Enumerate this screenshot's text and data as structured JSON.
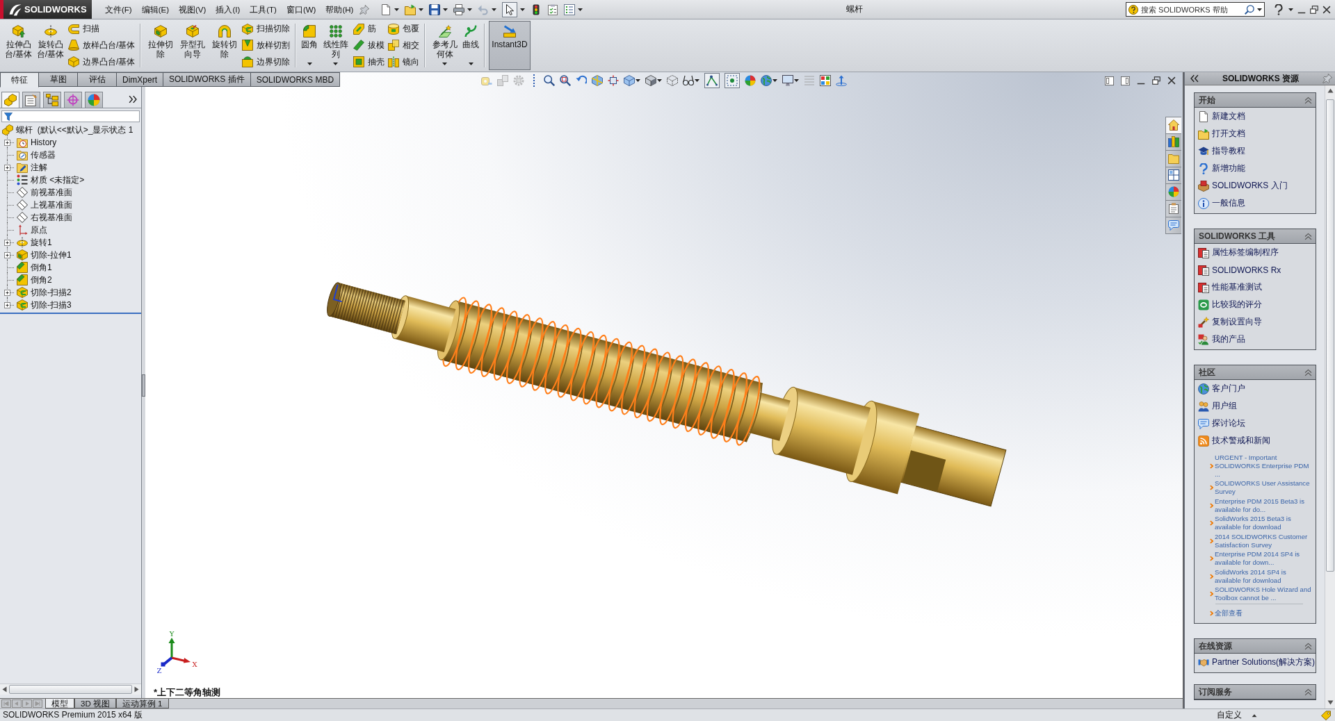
{
  "app": {
    "logo": "SOLIDWORKS"
  },
  "menu": [
    "文件(F)",
    "编辑(E)",
    "视图(V)",
    "插入(I)",
    "工具(T)",
    "窗口(W)",
    "帮助(H)"
  ],
  "quick_access": [
    {
      "dropdown": true,
      "on": false,
      "disabled": false
    },
    {
      "dropdown": true,
      "on": false,
      "disabled": false
    },
    {
      "dropdown": true,
      "on": false,
      "disabled": false
    },
    {
      "dropdown": true,
      "on": false,
      "disabled": false
    },
    {
      "dropdown": true,
      "on": false,
      "disabled": true
    },
    {
      "dropdown": true,
      "on": true,
      "disabled": false
    },
    {
      "dropdown": false,
      "on": false,
      "disabled": false
    },
    {
      "dropdown": false,
      "on": false,
      "disabled": false
    },
    {
      "dropdown": true,
      "on": false,
      "disabled": false
    }
  ],
  "window": {
    "title": "螺杆"
  },
  "search": {
    "placeholder": "搜索 SOLIDWORKS 帮助"
  },
  "ribbon": {
    "groups": [
      {
        "items": [
          {
            "kind": "large",
            "label": "拉伸凸台/基体",
            "dropdown": false,
            "on": false
          },
          {
            "kind": "large",
            "label": "旋转凸台/基体",
            "dropdown": false,
            "on": false
          },
          {
            "kind": "stack",
            "items": [
              {
                "label": "扫描"
              },
              {
                "label": "放样凸台/基体"
              },
              {
                "label": "边界凸台/基体"
              }
            ]
          }
        ]
      },
      {
        "items": [
          {
            "kind": "large",
            "label": "拉伸切除",
            "dropdown": false,
            "on": false
          },
          {
            "kind": "large",
            "label": "异型孔向导",
            "dropdown": false,
            "on": false
          },
          {
            "kind": "large",
            "label": "旋转切除",
            "dropdown": false,
            "on": false
          },
          {
            "kind": "stack",
            "items": [
              {
                "label": "扫描切除"
              },
              {
                "label": "放样切割"
              },
              {
                "label": "边界切除"
              }
            ]
          }
        ]
      },
      {
        "items": [
          {
            "kind": "large",
            "label": "圆角",
            "dropdown": true,
            "on": false
          },
          {
            "kind": "large",
            "label": "线性阵列",
            "dropdown": true,
            "on": false
          },
          {
            "kind": "stack",
            "items": [
              {
                "label": "筋"
              },
              {
                "label": "拔模"
              },
              {
                "label": "抽壳"
              }
            ]
          },
          {
            "kind": "stack",
            "items": [
              {
                "label": "包覆"
              },
              {
                "label": "相交"
              },
              {
                "label": "镜向"
              }
            ]
          }
        ]
      },
      {
        "items": [
          {
            "kind": "large",
            "label": "参考几何体",
            "dropdown": true,
            "on": false
          },
          {
            "kind": "large",
            "label": "曲线",
            "dropdown": true,
            "on": false
          }
        ]
      },
      {
        "items": [
          {
            "kind": "large",
            "label": "Instant3D",
            "dropdown": false,
            "on": true
          }
        ]
      }
    ]
  },
  "command_tabs": [
    {
      "label": "特征",
      "selected": true
    },
    {
      "label": "草图",
      "selected": false
    },
    {
      "label": "评估",
      "selected": false
    },
    {
      "label": "DimXpert",
      "selected": false
    },
    {
      "label": "SOLIDWORKS 插件",
      "selected": false
    },
    {
      "label": "SOLIDWORKS MBD",
      "selected": false
    }
  ],
  "view_toolbar": [
    {
      "dropdown": false,
      "on": false,
      "disabled": true
    },
    {
      "dropdown": false,
      "on": false,
      "disabled": true
    },
    {
      "dropdown": false,
      "on": false,
      "disabled": true
    },
    {
      "dropdown": false,
      "on": false,
      "disabled": false
    },
    {
      "dropdown": false,
      "on": false,
      "disabled": false
    },
    {
      "dropdown": false,
      "on": false,
      "disabled": false
    },
    {
      "dropdown": false,
      "on": false,
      "disabled": false
    },
    {
      "dropdown": false,
      "on": false,
      "disabled": false
    },
    {
      "dropdown": true,
      "on": false,
      "disabled": false
    },
    {
      "dropdown": true,
      "on": false,
      "disabled": false
    },
    {
      "dropdown": false,
      "on": false,
      "disabled": false
    },
    {
      "dropdown": true,
      "on": false,
      "disabled": false
    },
    {
      "dropdown": false,
      "on": true,
      "disabled": false
    },
    {
      "dropdown": false,
      "on": true,
      "disabled": false
    },
    {
      "dropdown": false,
      "on": false,
      "disabled": false
    },
    {
      "dropdown": true,
      "on": false,
      "disabled": false
    },
    {
      "dropdown": true,
      "on": false,
      "disabled": false
    },
    {
      "dropdown": false,
      "on": false,
      "disabled": true
    },
    {
      "dropdown": false,
      "on": false,
      "disabled": false
    },
    {
      "dropdown": false,
      "on": false,
      "disabled": false
    }
  ],
  "panel_tabs": [
    {
      "selected": true
    },
    {
      "selected": false
    },
    {
      "selected": false
    },
    {
      "selected": false
    },
    {
      "selected": false
    }
  ],
  "feature_tree": {
    "label": "螺杆  (默认<<默认>_显示状态 1",
    "children": [
      {
        "label": "History",
        "expandable": true
      },
      {
        "label": "传感器",
        "expandable": false
      },
      {
        "label": "注解",
        "expandable": true
      },
      {
        "label": "材质 <未指定>",
        "expandable": false
      },
      {
        "label": "前视基准面",
        "expandable": false
      },
      {
        "label": "上视基准面",
        "expandable": false
      },
      {
        "label": "右视基准面",
        "expandable": false
      },
      {
        "label": "原点",
        "expandable": false
      },
      {
        "label": "旋转1",
        "expandable": true
      },
      {
        "label": "切除-拉伸1",
        "expandable": true
      },
      {
        "label": "倒角1",
        "expandable": false
      },
      {
        "label": "倒角2",
        "expandable": false
      },
      {
        "label": "切除-扫描2",
        "expandable": true
      },
      {
        "label": "切除-扫描3",
        "expandable": true
      }
    ]
  },
  "viewport": {
    "view_name": "*上下二等角轴测",
    "triad": {
      "x": "X",
      "y": "Y",
      "z": "Z"
    }
  },
  "task_tabs": [
    {
      "selected": true
    },
    {
      "selected": false
    },
    {
      "selected": false
    },
    {
      "selected": false
    },
    {
      "selected": false
    },
    {
      "selected": false
    },
    {
      "selected": false
    }
  ],
  "task_pane": {
    "title": "SOLIDWORKS 资源",
    "sections": [
      {
        "title": "开始",
        "expanded": true,
        "items": [
          {
            "label": "新建文档"
          },
          {
            "label": "打开文档"
          },
          {
            "label": "指导教程"
          },
          {
            "label": "新增功能"
          },
          {
            "label": "SOLIDWORKS 入门"
          },
          {
            "label": "一般信息"
          }
        ]
      },
      {
        "title": "SOLIDWORKS 工具",
        "expanded": true,
        "items": [
          {
            "label": "属性标签编制程序"
          },
          {
            "label": "SOLIDWORKS Rx"
          },
          {
            "label": "性能基准测试"
          },
          {
            "label": "比较我的评分"
          },
          {
            "label": "复制设置向导"
          },
          {
            "label": "我的产品"
          }
        ]
      },
      {
        "title": "社区",
        "expanded": true,
        "items": [
          {
            "label": "客户门户"
          },
          {
            "label": "用户组"
          },
          {
            "label": "探讨论坛"
          },
          {
            "label": "技术警戒和新闻"
          }
        ],
        "news": [
          "URGENT - Important SOLIDWORKS Enterprise PDM ...",
          "SOLIDWORKS User Assistance Survey",
          "Enterprise PDM 2015 Beta3 is available for do...",
          "SolidWorks 2015 Beta3 is available for download",
          "2014 SOLIDWORKS Customer Satisfaction Survey",
          "Enterprise PDM 2014 SP4 is available for down...",
          "SolidWorks 2014 SP4 is available for download",
          "SOLIDWORKS Hole Wizard and Toolbox cannot be ..."
        ],
        "more": "全部查看"
      },
      {
        "title": "在线资源",
        "expanded": true,
        "items": [
          {
            "label": "Partner Solutions(解决方案)"
          }
        ]
      },
      {
        "title": "订阅服务",
        "expanded": true
      }
    ]
  },
  "bottom_tabs": [
    {
      "label": "模型",
      "selected": true
    },
    {
      "label": "3D 视图",
      "selected": false
    },
    {
      "label": "运动算例 1",
      "selected": false
    }
  ],
  "status_bar": {
    "text": "SOLIDWORKS Premium 2015 x64 版",
    "custom": "自定义"
  }
}
